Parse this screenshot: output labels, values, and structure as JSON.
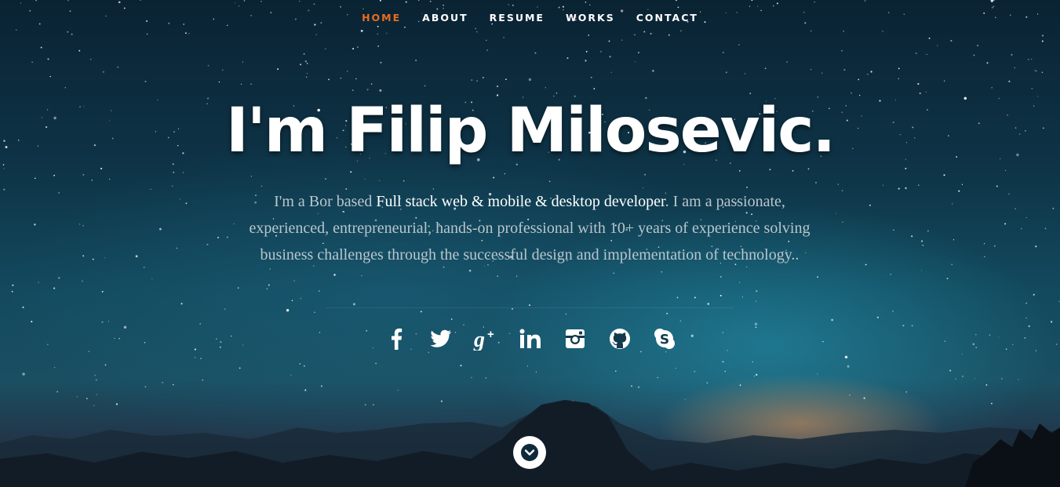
{
  "nav": {
    "items": [
      {
        "label": "HOME",
        "active": true
      },
      {
        "label": "ABOUT",
        "active": false
      },
      {
        "label": "RESUME",
        "active": false
      },
      {
        "label": "WORKS",
        "active": false
      },
      {
        "label": "CONTACT",
        "active": false
      }
    ],
    "active_color": "#e86d1f"
  },
  "hero": {
    "title": "I'm Filip Milosevic.",
    "intro_prefix": "I'm a Bor based ",
    "intro_highlight": "Full stack web & mobile & desktop developer",
    "intro_suffix": ". I am a passionate, experienced, entrepreneurial, hands-on professional with 10+ years of experience solving business challenges through the successful design and implementation of technology.."
  },
  "social": [
    {
      "icon": "facebook-icon"
    },
    {
      "icon": "twitter-icon"
    },
    {
      "icon": "google-plus-icon"
    },
    {
      "icon": "linkedin-icon"
    },
    {
      "icon": "instagram-icon"
    },
    {
      "icon": "github-icon"
    },
    {
      "icon": "skype-icon"
    }
  ],
  "scroll": {
    "icon": "chevron-down-icon"
  },
  "colors": {
    "sky_top": "#0a2333",
    "sky_mid": "#134a5e",
    "glow": "#e6965a"
  }
}
